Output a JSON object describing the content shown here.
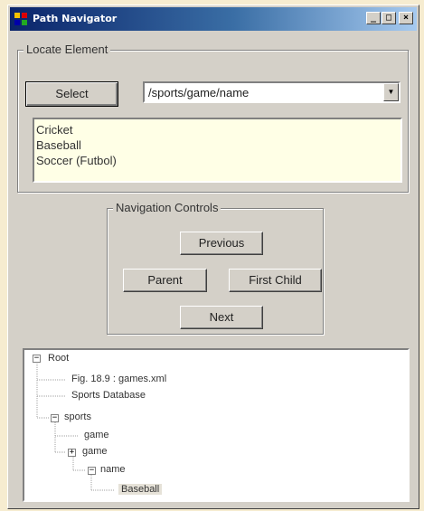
{
  "window": {
    "title": "Path Navigator",
    "controls": {
      "minimize": "_",
      "maximize": "□",
      "close": "×"
    }
  },
  "locate": {
    "group_label": "Locate Element",
    "select_label": "Select",
    "path_value": "/sports/game/name",
    "results": [
      "Cricket",
      "Baseball",
      "Soccer (Futbol)"
    ]
  },
  "navigation": {
    "group_label": "Navigation Controls",
    "previous_label": "Previous",
    "parent_label": "Parent",
    "first_child_label": "First Child",
    "next_label": "Next"
  },
  "tree": {
    "root": "Root",
    "file_caption": "Fig. 18.9 : games.xml",
    "db_caption": "Sports Database",
    "sports": "sports",
    "game1": "game",
    "game2": "game",
    "name": "name",
    "selected_value": "Baseball"
  },
  "colors": {
    "window_face": "#d4d0c8",
    "title_gradient_start": "#0a246a",
    "results_background": "#ffffe6",
    "tree_background": "#ffffff"
  }
}
